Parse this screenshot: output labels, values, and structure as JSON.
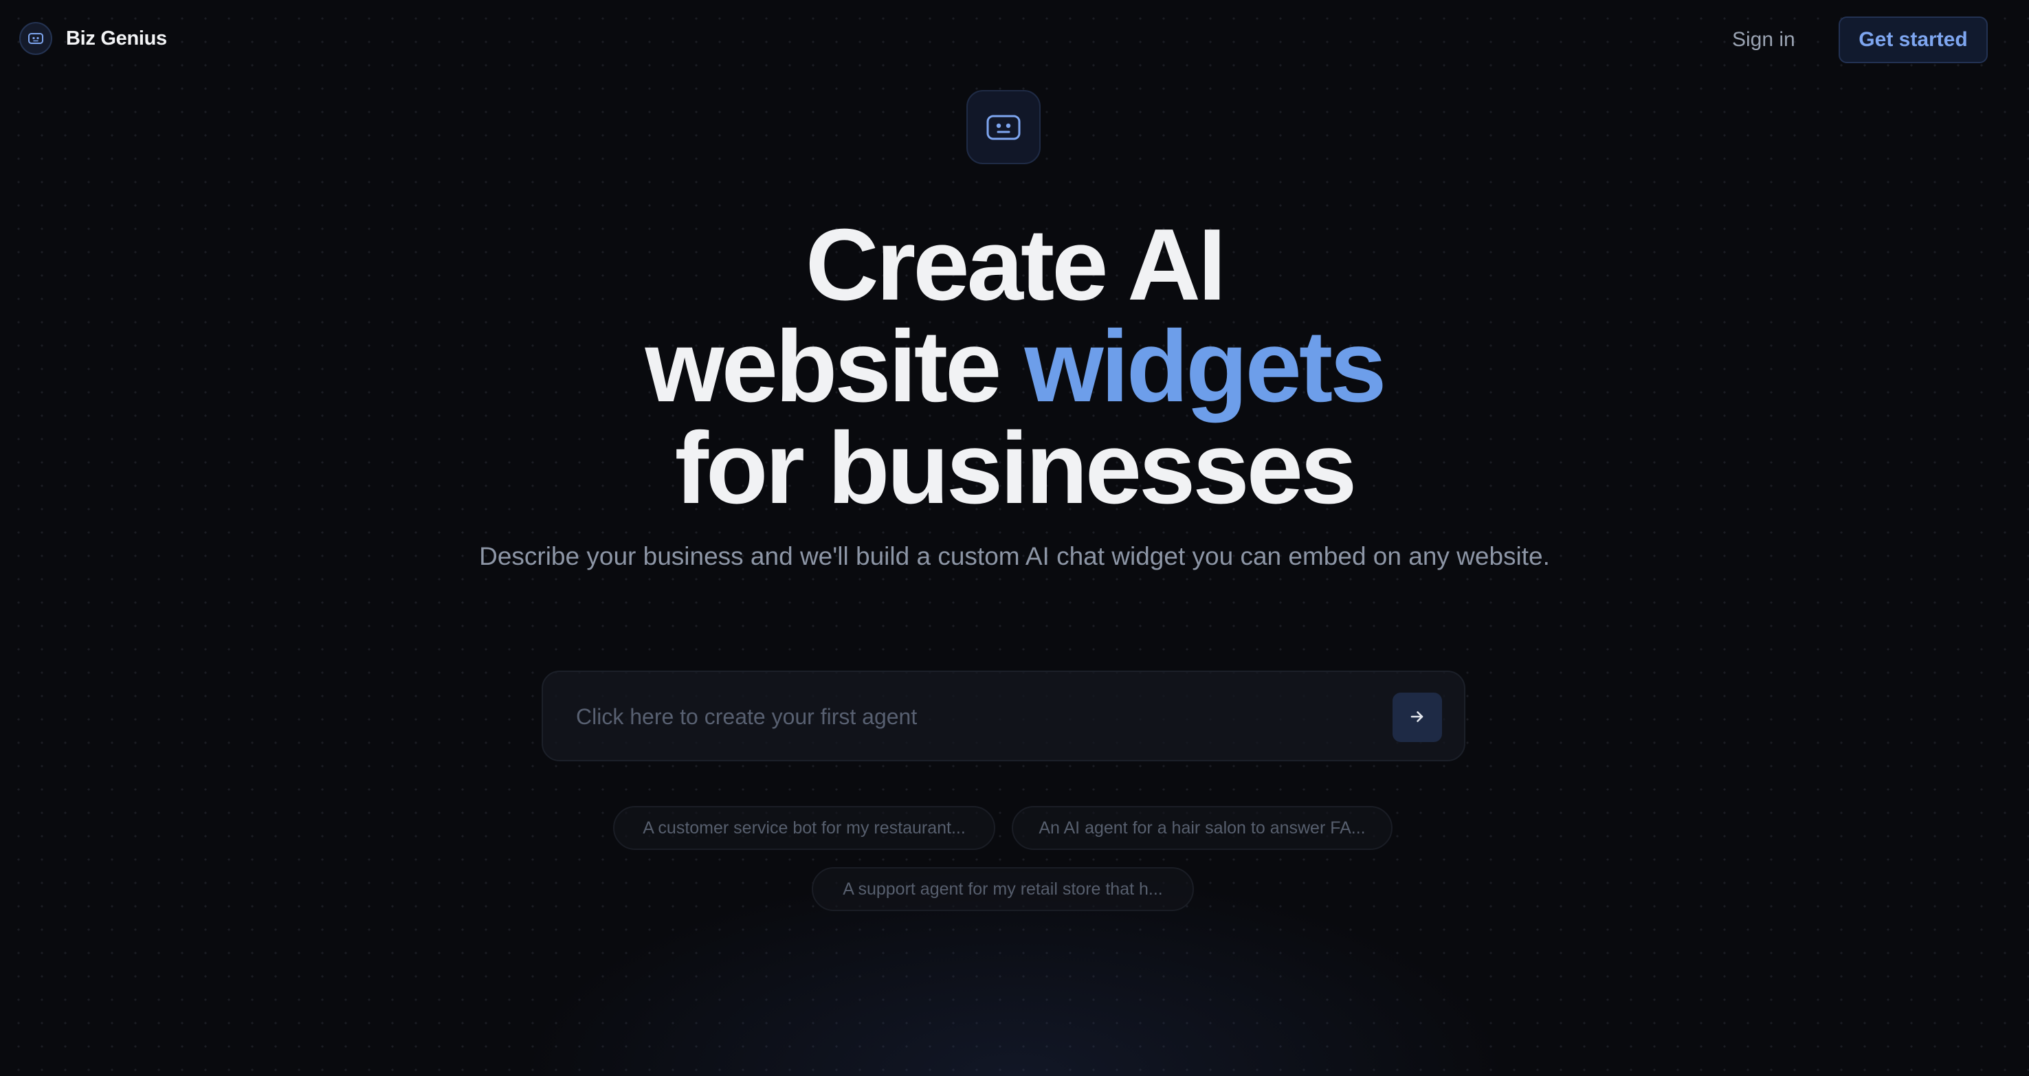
{
  "nav": {
    "brand_name": "Biz Genius",
    "brand_icon": "robot-face-icon",
    "sign_in_label": "Sign in",
    "get_started_label": "Get started"
  },
  "hero": {
    "icon": "robot-face-icon",
    "headline_line1": "Create AI",
    "headline_line2_prefix": "website ",
    "headline_line2_accent": "widgets",
    "headline_line3": "for businesses",
    "subtitle": "Describe your business and we'll build a custom AI chat widget you can embed on any website."
  },
  "prompt": {
    "placeholder": "Click here to create your first agent",
    "value": "",
    "submit_icon": "arrow-right-icon"
  },
  "suggestions": [
    "A customer service bot for my restaurant...",
    "An AI agent for a hair salon to answer FA...",
    "A support agent for my retail store that h..."
  ],
  "colors": {
    "background": "#090a0e",
    "accent": "#6d9eea",
    "button_text": "#7ea6f0",
    "muted_text": "#8d96a6"
  }
}
